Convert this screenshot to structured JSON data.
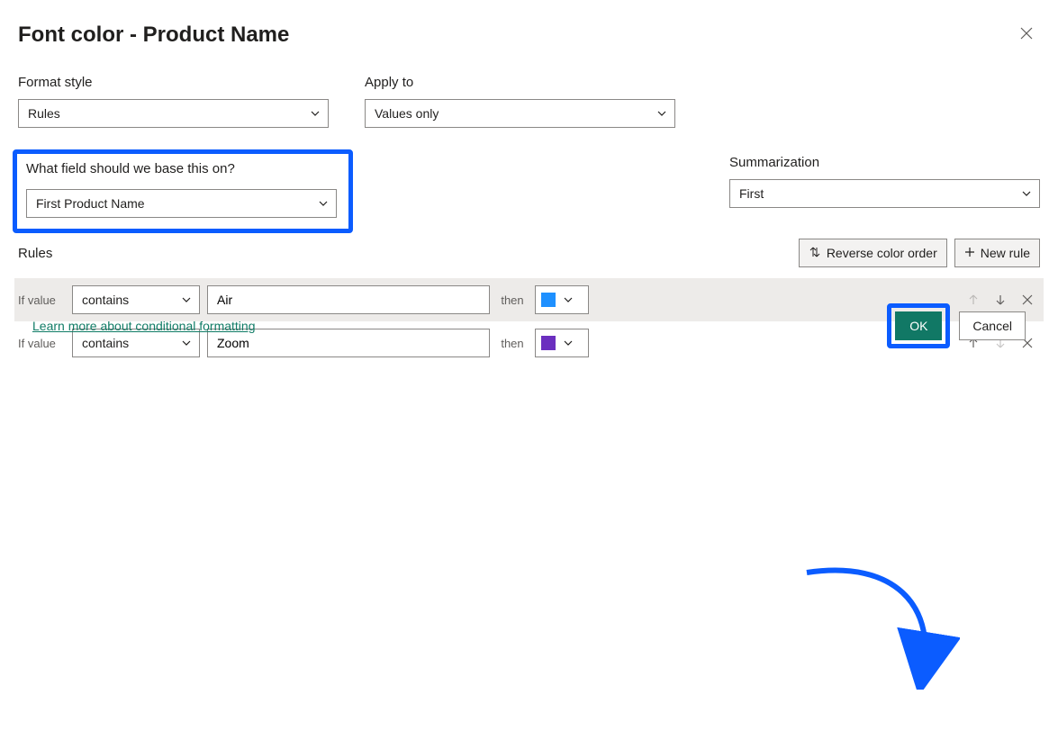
{
  "dialog": {
    "title": "Font color - Product Name"
  },
  "fields": {
    "format_style": {
      "label": "Format style",
      "value": "Rules"
    },
    "apply_to": {
      "label": "Apply to",
      "value": "Values only"
    },
    "base_field": {
      "label": "What field should we base this on?",
      "value": "First Product Name"
    },
    "summarization": {
      "label": "Summarization",
      "value": "First"
    }
  },
  "rules_section": {
    "label": "Rules",
    "reverse_btn": "Reverse color order",
    "new_btn": "New rule"
  },
  "rules": [
    {
      "if_label": "If value",
      "condition": "contains",
      "value": "Air",
      "then_label": "then",
      "color": "#1E90FF"
    },
    {
      "if_label": "If value",
      "condition": "contains",
      "value": "Zoom",
      "then_label": "then",
      "color": "#6B2FBF"
    }
  ],
  "footer": {
    "help_link": "Learn more about conditional formatting",
    "ok": "OK",
    "cancel": "Cancel"
  }
}
